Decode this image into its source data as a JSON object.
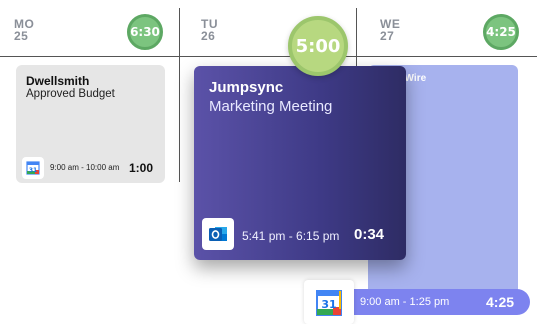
{
  "days": [
    {
      "weekday": "MO",
      "date": "25",
      "badge": "6:30"
    },
    {
      "weekday": "TU",
      "date": "26",
      "badge": "5:00"
    },
    {
      "weekday": "WE",
      "date": "27",
      "badge": "4:25"
    }
  ],
  "events": [
    {
      "company": "Dwellsmith",
      "title": "Approved Budget",
      "time": "9:00 am - 10:00 am",
      "duration": "1:00",
      "icon": "google-calendar-icon"
    },
    {
      "company": "Jumpsync",
      "title": "Marketing Meeting",
      "time": "5:41 pm - 6:15 pm",
      "duration": "0:34",
      "icon": "outlook-icon"
    },
    {
      "company": "eWire",
      "time": "9:00 am - 1:25 pm",
      "duration": "4:25",
      "icon": "google-calendar-icon"
    }
  ],
  "colors": {
    "gray_card": "#e6e6e6",
    "purple_card": "#3e3a86",
    "blue_card": "#a7b2ee",
    "pill": "#7d83ef",
    "badge_green": "#7cc47f",
    "badge_lime": "#b7d880"
  }
}
